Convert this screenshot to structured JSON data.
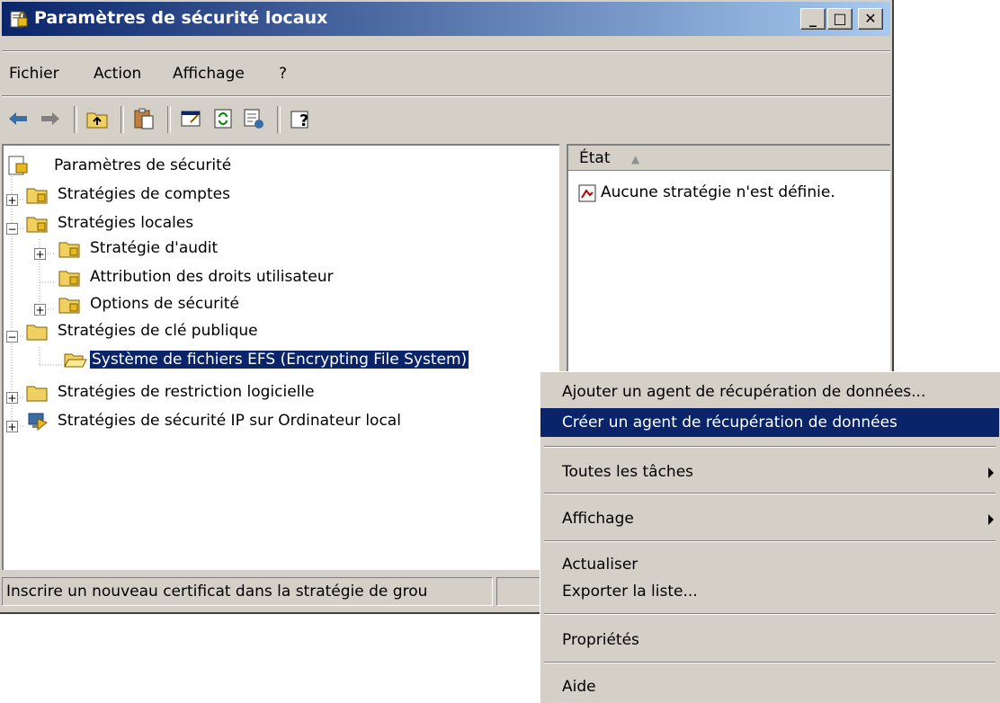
{
  "window": {
    "title": "Paramètres de sécurité locaux",
    "minimize": "_",
    "maximize": "□",
    "close": "✕"
  },
  "menu": [
    "Fichier",
    "Action",
    "Affichage",
    "?"
  ],
  "toolbar": [
    "back-icon",
    "forward-icon",
    "up-folder-icon",
    "paste-icon",
    "properties-icon",
    "refresh-icon",
    "export-icon",
    "help-icon"
  ],
  "tree": {
    "root": "Paramètres de sécurité",
    "items": [
      "Stratégies de comptes",
      "Stratégies locales",
      "Stratégie d'audit",
      "Attribution des droits utilisateur",
      "Options de sécurité",
      "Stratégies de clé publique",
      "Système de fichiers EFS (Encrypting File System)",
      "Stratégies de restriction logicielle",
      "Stratégies de sécurité IP sur Ordinateur local"
    ]
  },
  "details": {
    "column": "État",
    "sort": "▲",
    "empty": "Aucune stratégie n'est définie."
  },
  "status": {
    "text": "Inscrire un nouveau certificat dans la stratégie de grou"
  },
  "context_menu": [
    "Ajouter un agent de récupération de données...",
    "Créer un agent de récupération de données",
    "Toutes les tâches",
    "Affichage",
    "Actualiser",
    "Exporter la liste...",
    "Propriétés",
    "Aide"
  ],
  "colors": {
    "titlebar": "#0a246a",
    "selection": "#0a246a",
    "face": "#d4d0c8"
  }
}
